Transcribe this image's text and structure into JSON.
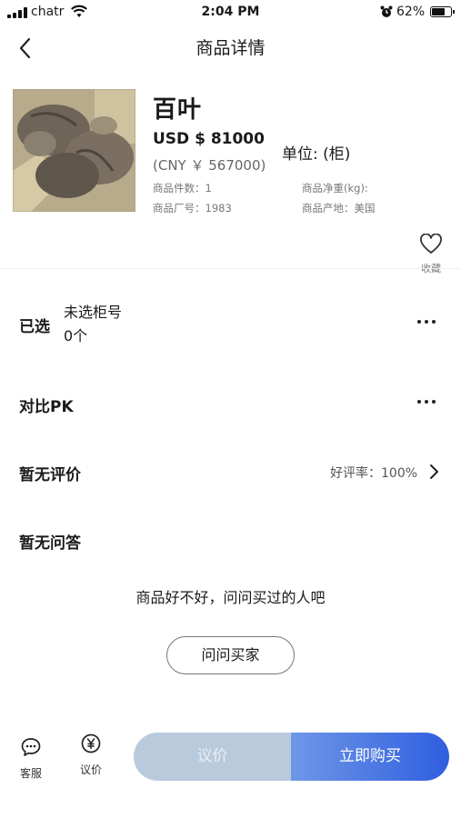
{
  "status_bar": {
    "carrier": "chatr",
    "time": "2:04 PM",
    "battery": "62%",
    "battery_level": 0.62
  },
  "nav": {
    "title": "商品详情",
    "back_icon": "chevron-left-icon"
  },
  "product": {
    "name": "百叶",
    "price_usd": "USD $ 81000",
    "price_cny": "(CNY ￥ 567000)",
    "unit": "单位: (柜)",
    "count_label": "商品件数：1",
    "factory_label": "商品厂号：1983",
    "weight_label": "商品净重(kg):",
    "origin_label": "商品产地：美国"
  },
  "favorite": {
    "label": "收藏",
    "icon": "heart-icon"
  },
  "selected": {
    "title": "已选",
    "line1": "未选柜号",
    "line2": "0个"
  },
  "compare": {
    "title": "对比PK"
  },
  "reviews": {
    "title": "暂无评价",
    "rate": "好评率：100%"
  },
  "qa": {
    "title": "暂无问答",
    "hint": "商品好不好，问问买过的人吧",
    "ask_button": "问问买家"
  },
  "bottom_bar": {
    "service_label": "客服",
    "bargain_icon_label": "议价",
    "bargain_button": "议价",
    "buy_button": "立即购买"
  },
  "colors": {
    "buy_start": "#6f97e6",
    "buy_end": "#2f5ee0",
    "bargain_bg": "#b9cadd"
  }
}
